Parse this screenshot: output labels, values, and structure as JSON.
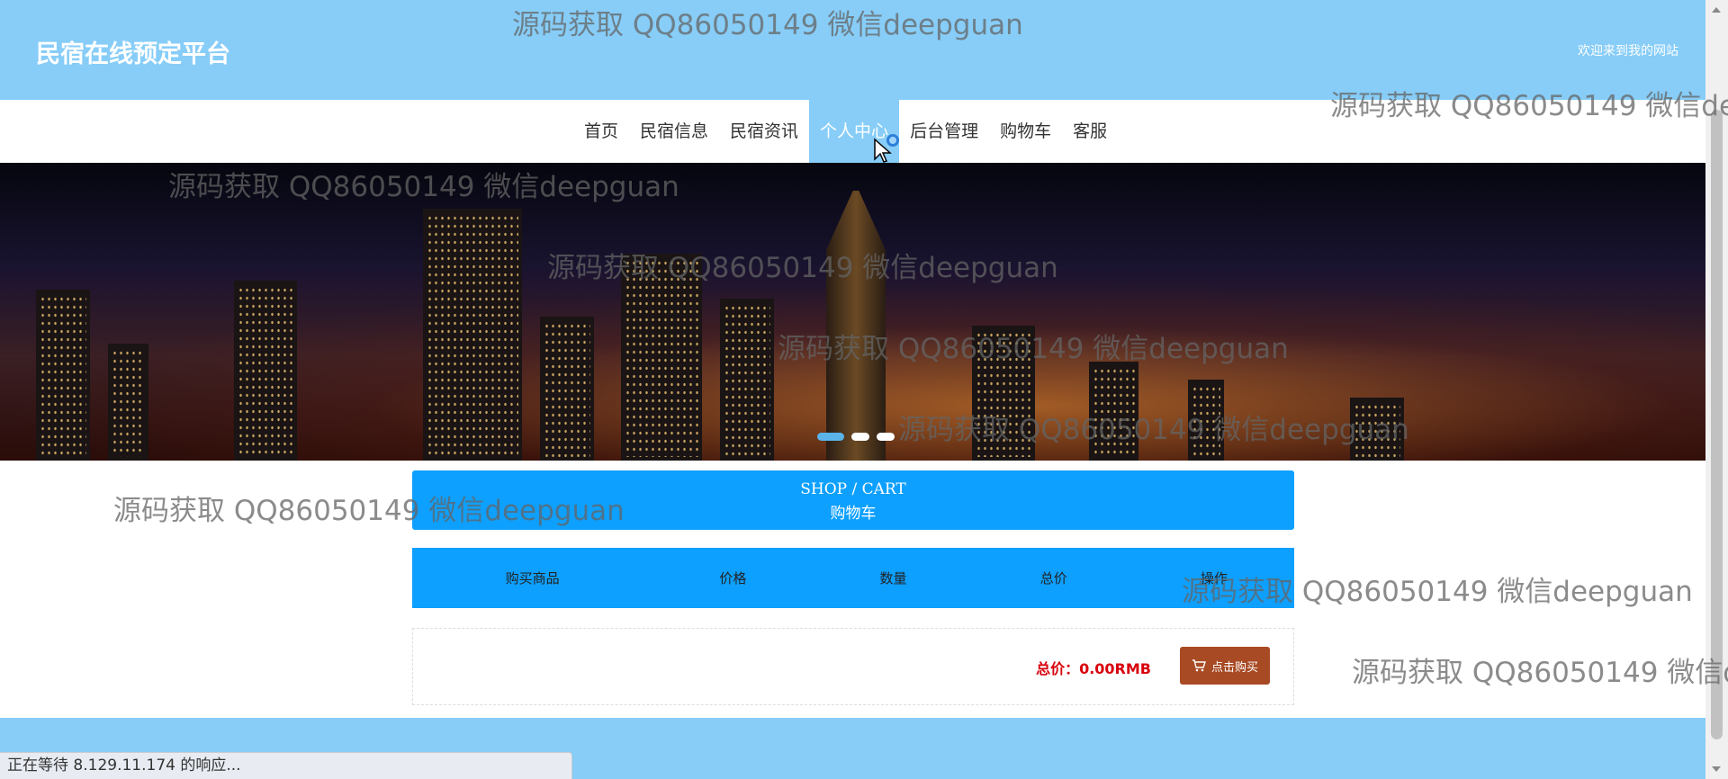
{
  "header": {
    "site_title": "民宿在线预定平台",
    "welcome": "欢迎来到我的网站"
  },
  "nav": {
    "items": [
      {
        "label": "首页"
      },
      {
        "label": "民宿信息"
      },
      {
        "label": "民宿资讯"
      },
      {
        "label": "个人中心",
        "active": true
      },
      {
        "label": "后台管理"
      },
      {
        "label": "购物车"
      },
      {
        "label": "客服"
      }
    ]
  },
  "carousel": {
    "slides": 3,
    "active_index": 0
  },
  "cart": {
    "title_en": "SHOP / CART",
    "title_cn": "购物车",
    "columns": [
      "购买商品",
      "价格",
      "数量",
      "总价",
      "操作"
    ],
    "rows": [],
    "total_label": "总价：0.00RMB",
    "buy_label": "点击购买"
  },
  "browser": {
    "status_text": "正在等待 8.129.11.174 的响应..."
  },
  "watermark": {
    "text": "源码获取 QQ86050149 微信deepguan"
  },
  "colors": {
    "header_bg": "#87cdf8",
    "accent_blue": "#0ea0ff",
    "buy_button": "#a84a24",
    "total_red": "#d8000c"
  },
  "icons": [
    "cart-icon",
    "cursor-icon",
    "loading-icon"
  ]
}
